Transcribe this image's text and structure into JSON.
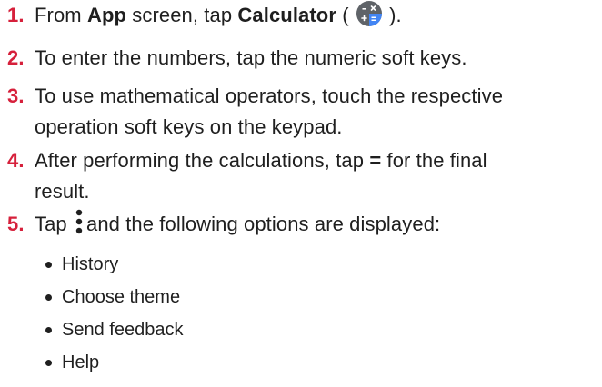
{
  "steps": [
    {
      "number": "1.",
      "prefix": "From ",
      "bold_app": "App",
      "mid": " screen, tap ",
      "bold_calculator": "Calculator",
      "open_paren": " (",
      "close_paren": ")."
    },
    {
      "number": "2.",
      "text": "To enter the numbers, tap the numeric soft keys."
    },
    {
      "number": "3.",
      "line1": "To use mathematical operators, touch the respective",
      "line2": "operation soft keys on the keypad."
    },
    {
      "number": "4.",
      "prefix": "After performing the calculations, tap ",
      "bold_equals": "=",
      "suffix": " for the final",
      "line2": "result."
    },
    {
      "number": "5.",
      "prefix": "Tap ",
      "suffix": "and the following options are displayed:"
    }
  ],
  "options": [
    "History",
    "Choose theme",
    "Send feedback",
    "Help"
  ],
  "icons": {
    "calculator": "calculator-app-icon",
    "menu": "more-vert-icon"
  },
  "colors": {
    "step_number": "#d6203b",
    "calc_dark": "#5f6368",
    "calc_blue": "#4285f4",
    "text": "#1f1f1f"
  }
}
